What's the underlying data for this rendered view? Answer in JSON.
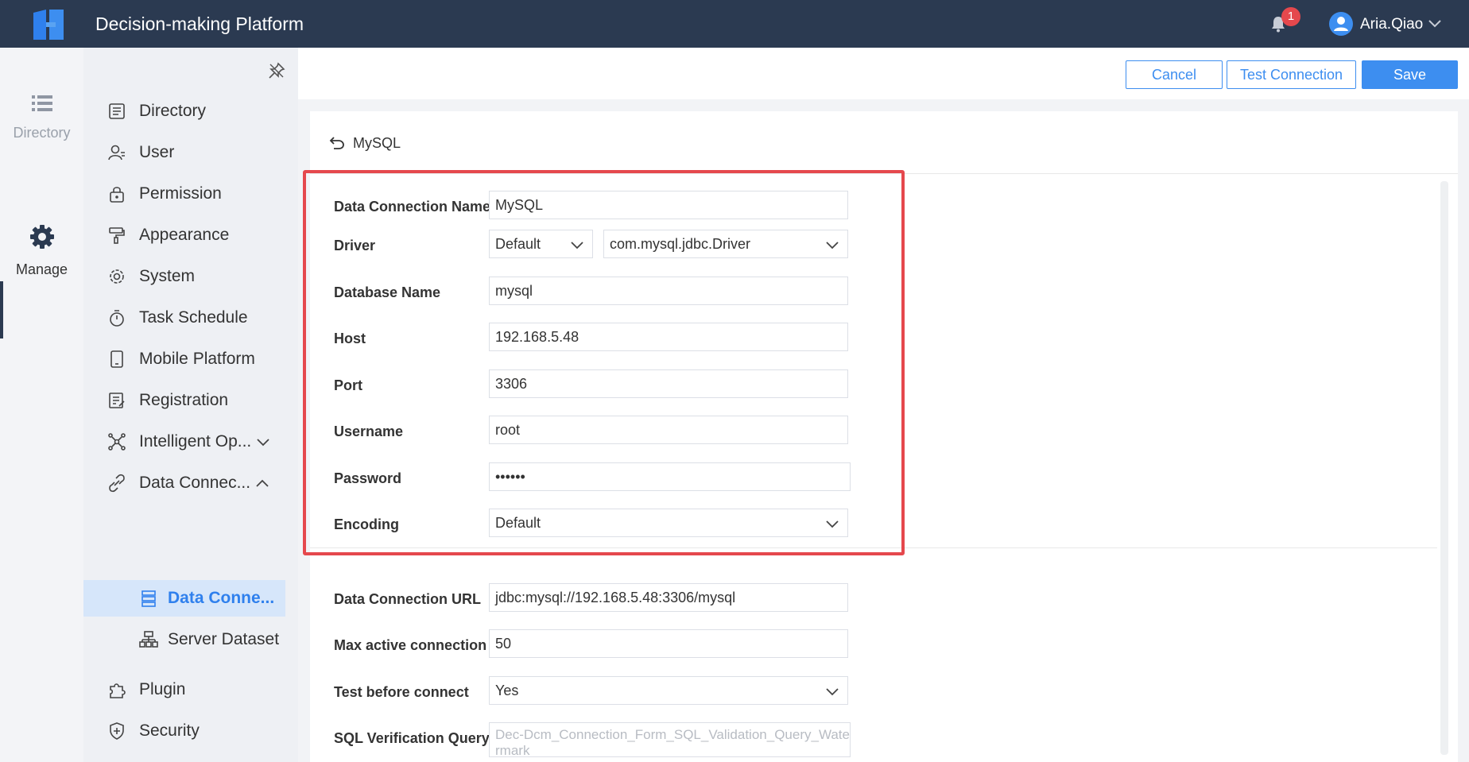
{
  "header": {
    "app_title": "Decision-making Platform",
    "notification_count": "1",
    "user_name": "Aria.Qiao"
  },
  "rail": {
    "items": [
      {
        "label": "Directory",
        "icon": "list-icon"
      },
      {
        "label": "Manage",
        "icon": "gear-icon",
        "active": true
      }
    ]
  },
  "nav": {
    "items": [
      {
        "label": "Directory",
        "icon": "directory-icon"
      },
      {
        "label": "User",
        "icon": "user-icon"
      },
      {
        "label": "Permission",
        "icon": "lock-icon"
      },
      {
        "label": "Appearance",
        "icon": "paint-roller-icon"
      },
      {
        "label": "System",
        "icon": "gear-icon"
      },
      {
        "label": "Task Schedule",
        "icon": "stopwatch-icon"
      },
      {
        "label": "Mobile Platform",
        "icon": "tablet-icon"
      },
      {
        "label": "Registration",
        "icon": "registration-icon"
      },
      {
        "label": "Intelligent Op...",
        "icon": "network-icon",
        "expandable": "collapsed"
      },
      {
        "label": "Data Connec...",
        "icon": "link-icon",
        "expandable": "expanded"
      },
      {
        "label": "Plugin",
        "icon": "puzzle-icon"
      },
      {
        "label": "Security",
        "icon": "shield-icon"
      }
    ],
    "sub_items": [
      {
        "label": "Data Conne...",
        "icon": "database-icon",
        "active": true
      },
      {
        "label": "Server Dataset",
        "icon": "dataset-icon"
      }
    ]
  },
  "toolbar": {
    "cancel_label": "Cancel",
    "test_label": "Test Connection",
    "save_label": "Save"
  },
  "form": {
    "title": "MySQL",
    "fields": {
      "connection_name": {
        "label": "Data Connection Name",
        "value": "MySQL"
      },
      "driver": {
        "label": "Driver",
        "type_value": "Default",
        "class_value": "com.mysql.jdbc.Driver"
      },
      "database_name": {
        "label": "Database Name",
        "value": "mysql"
      },
      "host": {
        "label": "Host",
        "value": "192.168.5.48"
      },
      "port": {
        "label": "Port",
        "value": "3306"
      },
      "username": {
        "label": "Username",
        "value": "root"
      },
      "password": {
        "label": "Password",
        "value": "••••••"
      },
      "encoding": {
        "label": "Encoding",
        "value": "Default"
      },
      "url": {
        "label": "Data Connection URL",
        "value": "jdbc:mysql://192.168.5.48:3306/mysql"
      },
      "max_active": {
        "label": "Max active connection",
        "value": "50"
      },
      "test_before": {
        "label": "Test before connect",
        "value": "Yes"
      },
      "sql_query": {
        "label": "SQL Verification Query",
        "placeholder": "Dec-Dcm_Connection_Form_SQL_Validation_Query_Watermark"
      }
    }
  },
  "colors": {
    "topbar": "#2b3a51",
    "accent": "#3d8ef0",
    "highlight": "#e5484d"
  }
}
